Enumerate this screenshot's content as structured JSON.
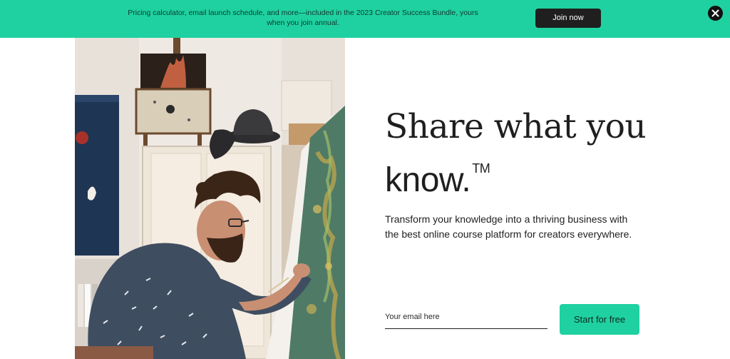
{
  "banner": {
    "text": "Pricing calculator, email launch schedule, and more—included in the 2023 Creator Success Bundle, yours when you join annual.",
    "join_label": "Join now",
    "close_icon": "close-icon"
  },
  "hero": {
    "image": "artist-painting-canvas-photo",
    "headline_line1": "Share what you",
    "headline_line2": "know.",
    "trademark": "TM",
    "subheadline": "Transform your knowledge into a thriving business with the best online course platform for creators everywhere.",
    "email_placeholder": "Your email here",
    "email_value": "",
    "cta_label": "Start for free"
  },
  "colors": {
    "accent": "#1fd1a0",
    "dark": "#1f1f1f",
    "background": "#ffffff"
  }
}
